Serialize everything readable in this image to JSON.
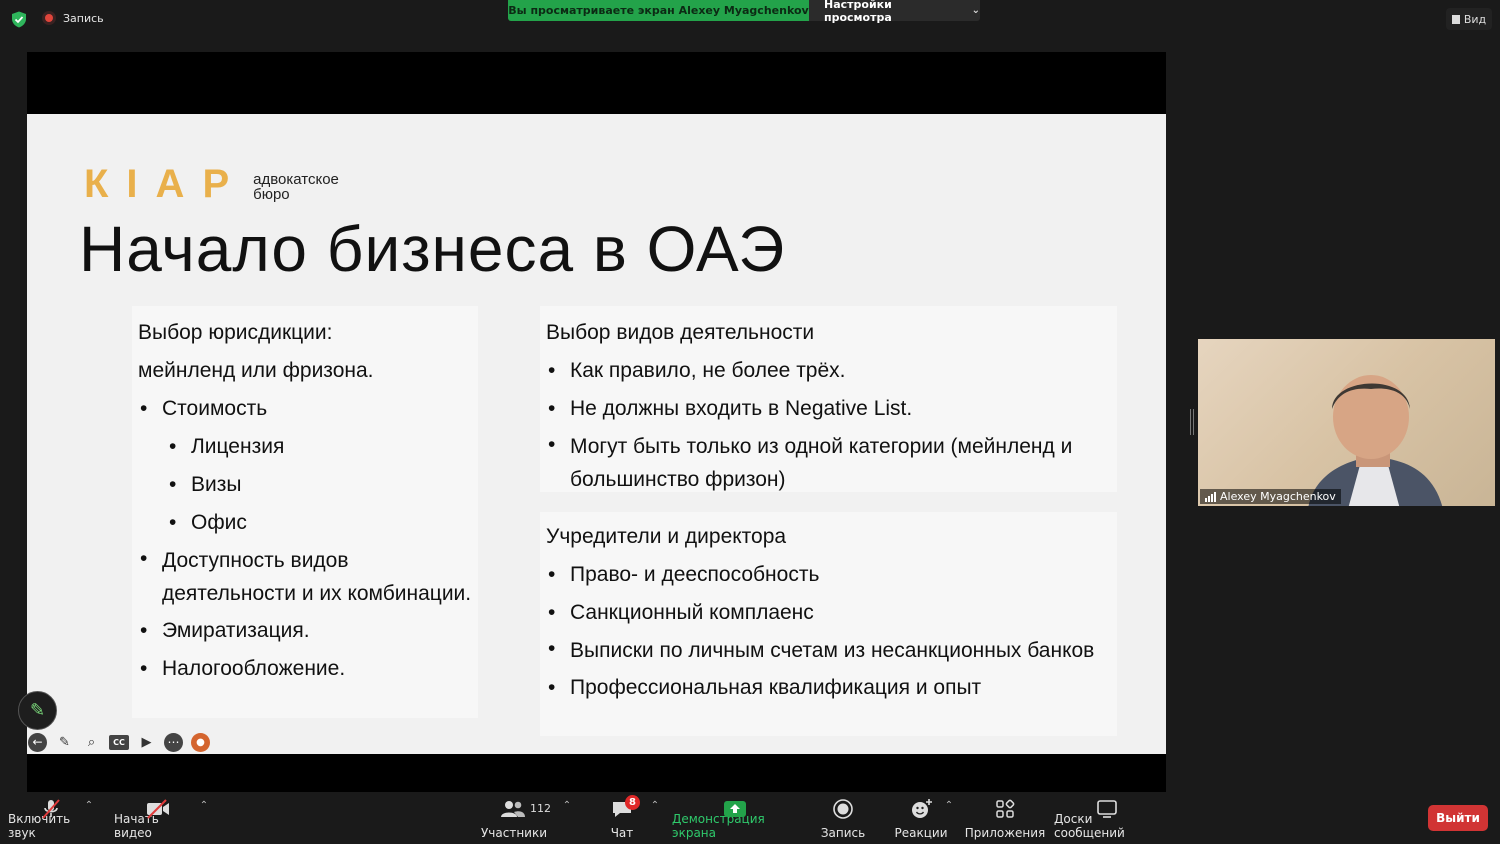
{
  "topbar": {
    "recording_label": "Запись",
    "viewing_banner": "Вы просматриваете экран Alexey Myagchenkov",
    "view_settings_label": "Настройки просмотра",
    "view_button_label": "Вид"
  },
  "slide": {
    "logo_letters": [
      "К",
      "І",
      "А",
      "Р"
    ],
    "logo_subtitle_line1": "адвокатское",
    "logo_subtitle_line2": "бюро",
    "title": "Начало бизнеса в ОАЭ",
    "left_box": {
      "heading_line1": "Выбор юрисдикции:",
      "heading_line2": "мейнленд или фризона.",
      "items": [
        "Стоимость",
        "Лицензия",
        "Визы",
        "Офис",
        "Доступность видов деятельности и их комбинации.",
        "Эмиратизация.",
        "Налогообложение."
      ]
    },
    "right_box_1": {
      "heading": "Выбор видов деятельности",
      "items": [
        "Как правило, не более трёх.",
        "Не должны входить в Negative List.",
        "Могут быть только из одной категории (мейнленд и большинство фризон)"
      ]
    },
    "right_box_2": {
      "heading": "Учредители и директора",
      "items": [
        "Право- и дееспособность",
        "Санкционный комплаенс",
        "Выписки по личным счетам из несанкционных банков",
        "Профессиональная квалификация и опыт"
      ]
    }
  },
  "annotation_toolbar": {
    "cc_label": "CC"
  },
  "video": {
    "participant_name": "Alexey Myagchenkov"
  },
  "bottombar": {
    "unmute_label": "Включить звук",
    "start_video_label": "Начать видео",
    "participants_label": "Участники",
    "participants_count": "112",
    "chat_label": "Чат",
    "chat_badge": "8",
    "share_label": "Демонстрация экрана",
    "record_label": "Запись",
    "reactions_label": "Реакции",
    "apps_label": "Приложения",
    "boards_label": "Доски сообщений",
    "leave_label": "Выйти"
  },
  "colors": {
    "brand_logo": "#e9b04b",
    "share_green": "#23a34a",
    "leave_red": "#d13434"
  }
}
